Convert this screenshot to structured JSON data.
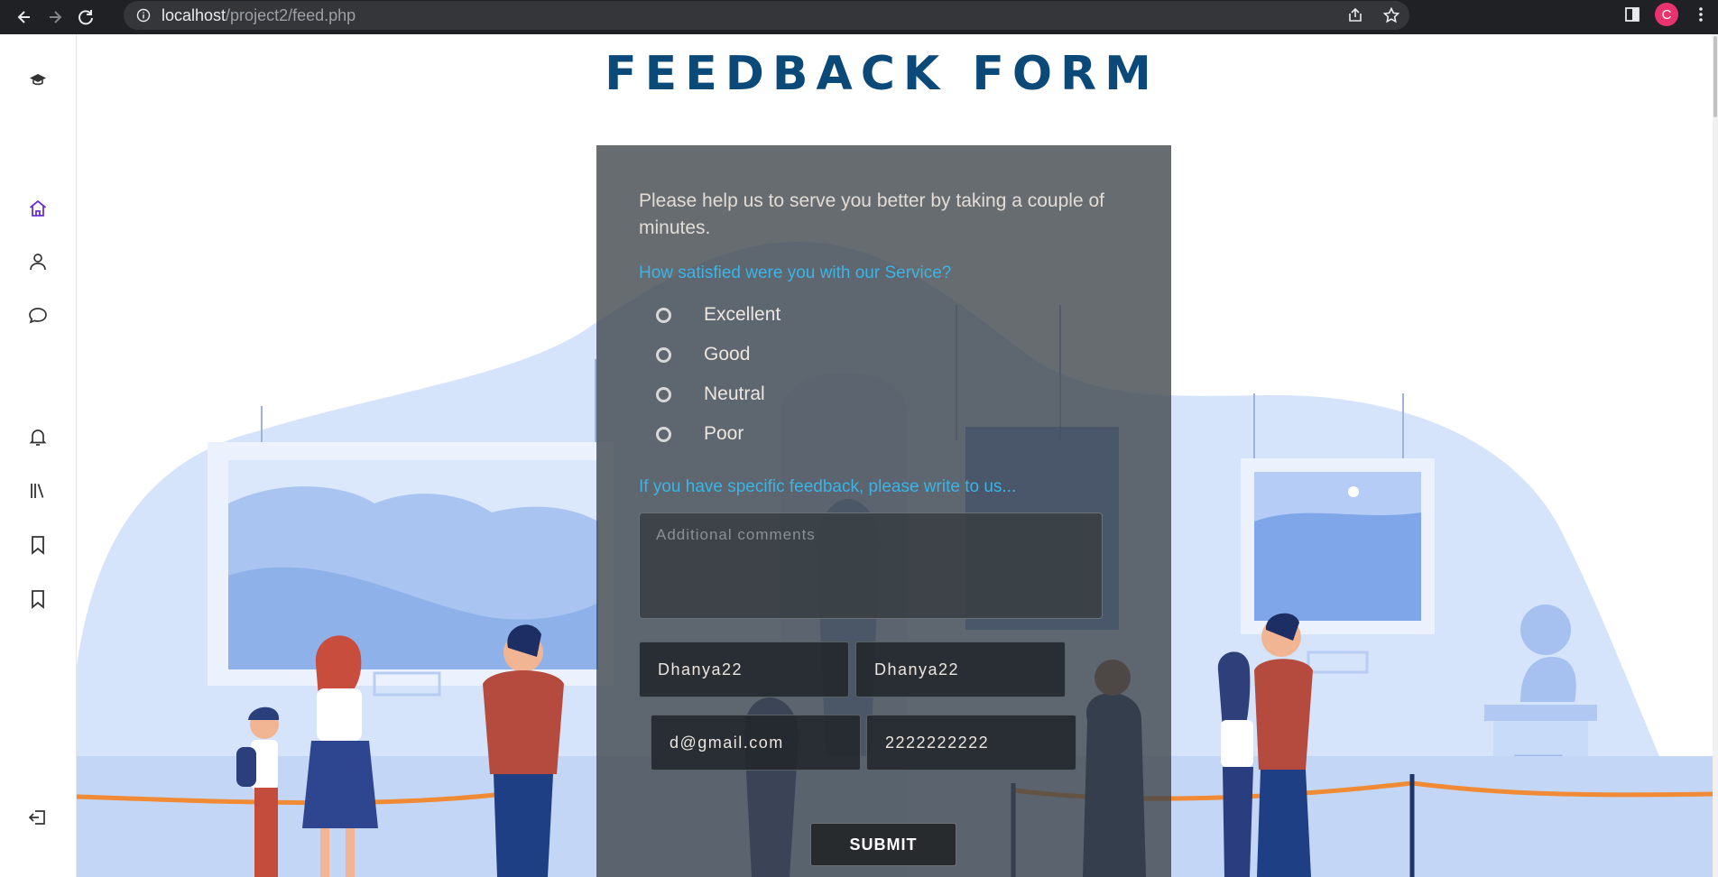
{
  "browser": {
    "url_host": "localhost",
    "url_path": "/project2/feed.php",
    "profile_initial": "C"
  },
  "sidebar": {
    "items": [
      {
        "icon": "graduation-cap-icon"
      },
      {
        "icon": "home-icon",
        "active": true
      },
      {
        "icon": "user-icon"
      },
      {
        "icon": "chat-icon"
      },
      {
        "icon": "bell-icon"
      },
      {
        "icon": "library-icon"
      },
      {
        "icon": "bookmark-icon"
      },
      {
        "icon": "bookmark-icon"
      },
      {
        "icon": "logout-icon"
      }
    ]
  },
  "page": {
    "title": "FEEDBACK FORM"
  },
  "form": {
    "intro": "Please help us to serve you better by taking a couple of minutes.",
    "question": "How satisfied were you with our Service?",
    "options": [
      "Excellent",
      "Good",
      "Neutral",
      "Poor"
    ],
    "specific_prompt": "If you have specific feedback, please write to us...",
    "comments_placeholder": "Additional comments",
    "first_name": "Dhanya22",
    "last_name": "Dhanya22",
    "email": "d@gmail.com",
    "phone": "2222222222",
    "submit_label": "SUBMIT"
  },
  "colors": {
    "title": "#0b4a78",
    "accent_text": "#3cb4e6",
    "panel": "#3c4348",
    "active_icon": "#6b2fd6"
  }
}
